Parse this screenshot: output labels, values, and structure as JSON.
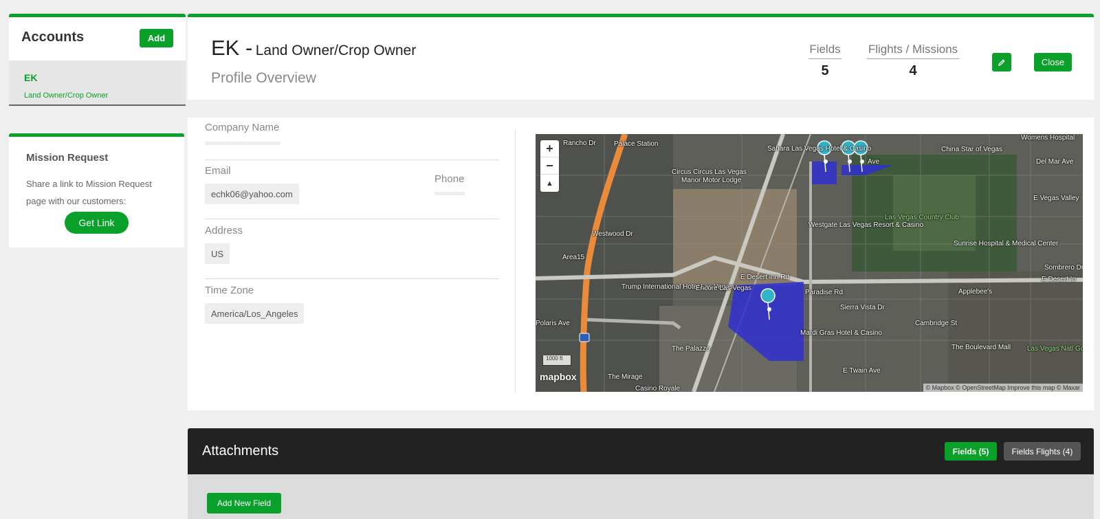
{
  "accounts": {
    "title": "Accounts",
    "add_label": "Add",
    "items": [
      {
        "name": "EK",
        "role": "Land Owner/Crop Owner"
      }
    ]
  },
  "mission_request": {
    "title": "Mission Request",
    "description": "Share a link to Mission Request page with our customers:",
    "button_label": "Get Link"
  },
  "profile": {
    "code": "EK -",
    "role": "Land Owner/Crop Owner",
    "subtitle": "Profile Overview",
    "stats": {
      "fields_label": "Fields",
      "fields_value": "5",
      "flights_label": "Flights / Missions",
      "flights_value": "4"
    },
    "edit_icon": "pencil-icon",
    "close_label": "Close"
  },
  "details": {
    "company_label": "Company Name",
    "company_value": "",
    "email_label": "Email",
    "email_value": "echk06@yahoo.com",
    "phone_label": "Phone",
    "phone_value": "",
    "address_label": "Address",
    "address_value": "US",
    "timezone_label": "Time Zone",
    "timezone_value": "America/Los_Angeles"
  },
  "map": {
    "zoom_in": "+",
    "zoom_out": "−",
    "compass": "▲",
    "scale": "1000 ft",
    "logo": "mapbox",
    "attribution": "© Mapbox © OpenStreetMap Improve this map © Maxar",
    "labels": [
      "Palace Station",
      "Sahara Las Vegas Hotel & Casino",
      "China Star of Vegas",
      "Circus Circus Las Vegas",
      "Manor Motor Lodge",
      "Westgate Las Vegas Resort & Casino",
      "Las Vegas Country Club",
      "Sunrise Hospital & Medical Center",
      "Area15",
      "Trump International Hotel Las Vegas",
      "Encore Las Vegas",
      "E Desert Inn Rd",
      "Sierra Vista Dr",
      "Applebee's",
      "Mardi Gras Hotel & Casino",
      "The Palazzo",
      "The Mirage",
      "Casino Royale",
      "E Twain Ave",
      "The Boulevard Mall",
      "Cambridge St",
      "Paradise Rd",
      "Sombrero Dr",
      "E Desert In",
      "Las Vegas Natl Golf Club",
      "Womens Hospital",
      "Del Mar Ave",
      "E Vegas Valley",
      "Westwood Dr",
      "Rancho Dr",
      "Polaris Ave",
      "Ave"
    ],
    "accent_fill": "#2f2fd0"
  },
  "attachments": {
    "title": "Attachments",
    "tab_fields": "Fields (5)",
    "tab_flights": "Fields Flights (4)",
    "add_field_label": "Add New Field"
  },
  "colors": {
    "brand_green": "#0aa12a",
    "dark_bar": "#222222"
  }
}
